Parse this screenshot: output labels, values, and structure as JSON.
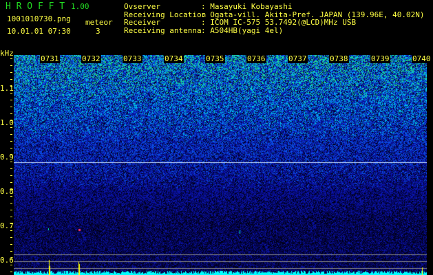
{
  "app": {
    "title": "H R O F F T",
    "version": "1.00"
  },
  "file": {
    "name": "1001010730.png",
    "datetime": "10.01.01 07:30"
  },
  "meteor": {
    "label": "meteor",
    "count": "3"
  },
  "info": [
    {
      "label": "Ovserver",
      "value": ": Masayuki Kobayashi"
    },
    {
      "label": "Receiving Location",
      "value": ": Ogata-vill. Akita-Pref. JAPAN (139.96E, 40.02N)"
    },
    {
      "label": "Receiver",
      "value": ": ICOM IC-575 53.7492(@LCD)MHz USB"
    },
    {
      "label": "Receiving antenna",
      "value": ": A504HB(yagi 4el)"
    }
  ],
  "axis": {
    "unit": "kHz",
    "ticks": [
      "1.1",
      "1.0",
      "0.9",
      "0.8",
      "0.7",
      "0.6"
    ],
    "times": [
      "0731",
      "0732",
      "0733",
      "0734",
      "0735",
      "0736",
      "0737",
      "0738",
      "0739",
      "0740"
    ]
  },
  "colors": {
    "text": "#ffff44",
    "title": "#22dd22",
    "baseline": "#00ffff"
  }
}
